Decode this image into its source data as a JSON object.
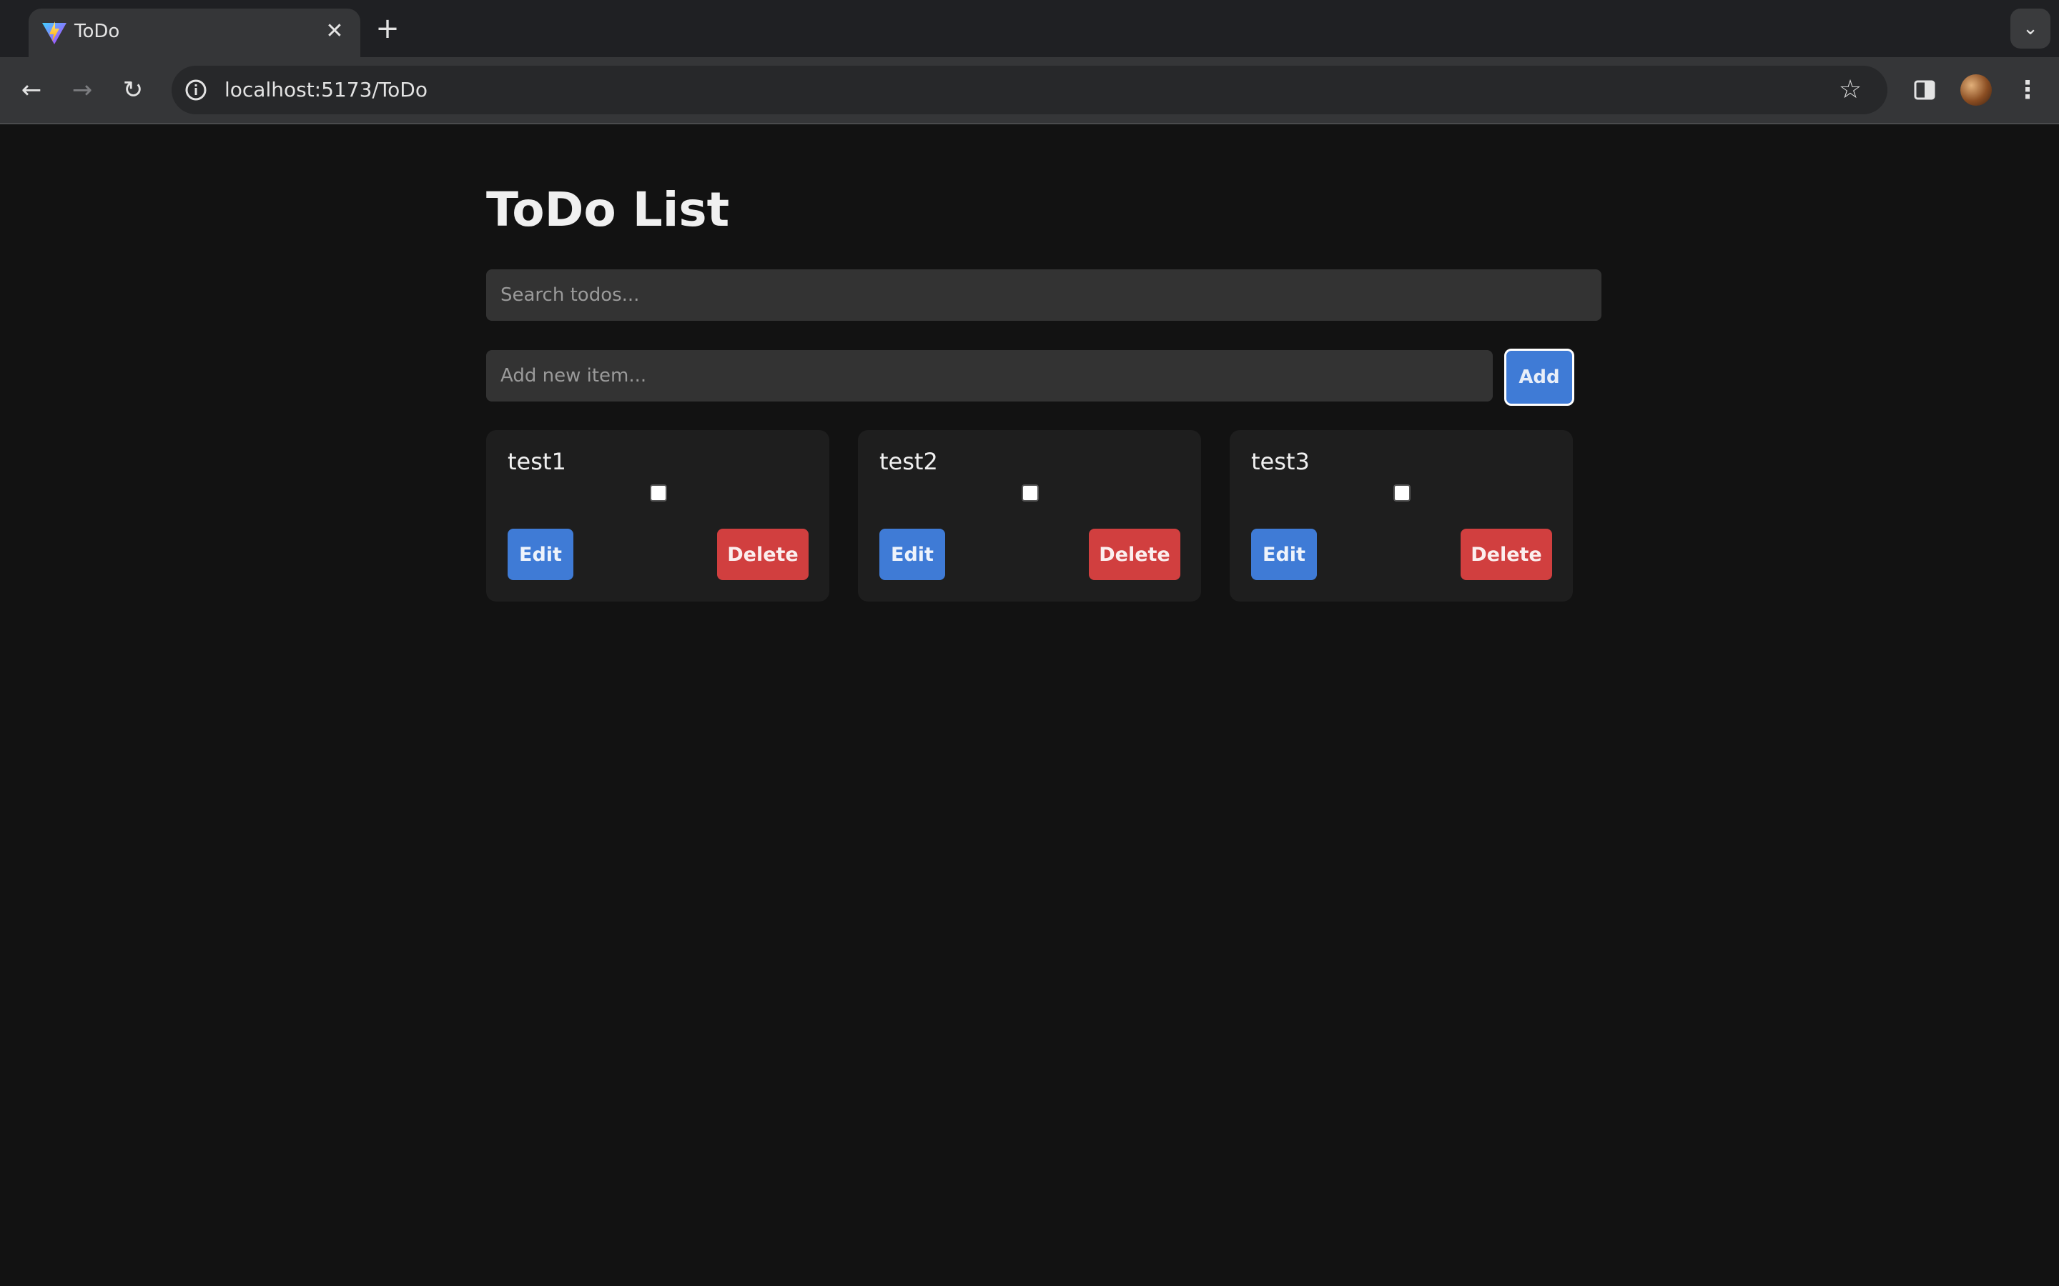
{
  "browser": {
    "tab": {
      "title": "ToDo",
      "close_glyph": "✕"
    },
    "new_tab_glyph": "+",
    "tab_menu_glyph": "⌄",
    "nav": {
      "back_glyph": "←",
      "forward_glyph": "→",
      "reload_glyph": "↻"
    },
    "url": "localhost:5173/ToDo",
    "bookmark_glyph": "☆",
    "menu_glyph": "⋮",
    "icons": [
      "vite-favicon-icon",
      "back-arrow-icon",
      "forward-arrow-icon",
      "reload-icon",
      "site-info-icon",
      "bookmark-star-icon",
      "side-panel-icon",
      "profile-avatar",
      "more-menu-icon"
    ]
  },
  "app": {
    "title": "ToDo List",
    "search": {
      "placeholder": "Search todos...",
      "value": ""
    },
    "new_item": {
      "placeholder": "Add new item...",
      "value": ""
    },
    "add_label": "Add",
    "todos": [
      {
        "text": "test1",
        "completed": false,
        "edit_label": "Edit",
        "delete_label": "Delete"
      },
      {
        "text": "test2",
        "completed": false,
        "edit_label": "Edit",
        "delete_label": "Delete"
      },
      {
        "text": "test3",
        "completed": false,
        "edit_label": "Edit",
        "delete_label": "Delete"
      }
    ]
  },
  "colors": {
    "page_background": "#121212",
    "card_background": "#1e1e1e",
    "input_background": "#333333",
    "primary_button": "#3f7bd6",
    "danger_button": "#d13f3f"
  }
}
